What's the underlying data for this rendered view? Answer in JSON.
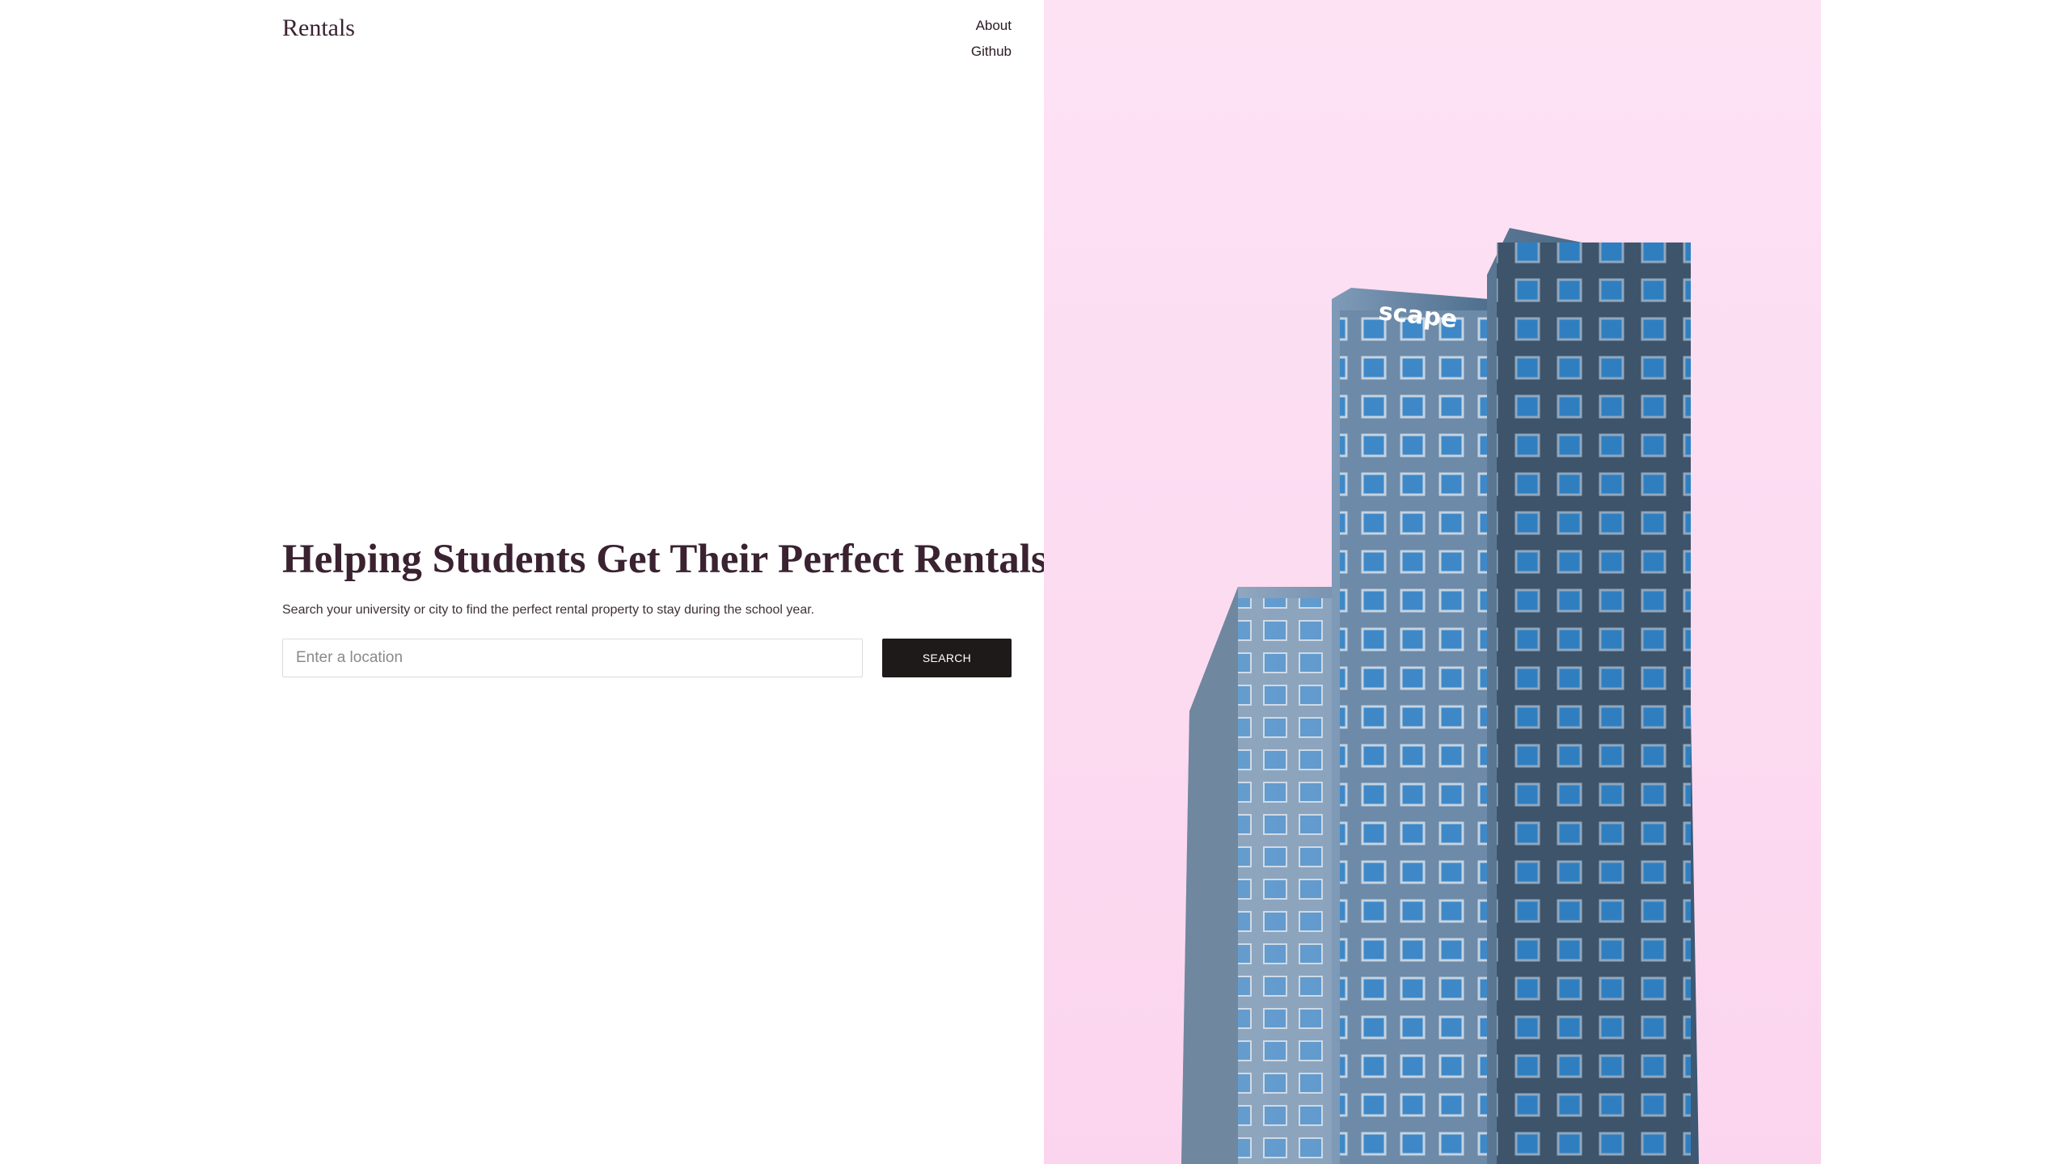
{
  "brand": {
    "title": "Rentals"
  },
  "nav": {
    "about": "About",
    "github": "Github"
  },
  "hero": {
    "headline": "Helping Students Get Their Perfect Rentals.",
    "subtitle": "Search your university or city to find the perfect rental property to stay during the school year.",
    "search": {
      "placeholder": "Enter a location",
      "value": "",
      "button_label": "SEARCH"
    }
  },
  "image": {
    "sign_text": "scape",
    "sky_color": "#fcdcf1",
    "building_color": "#5b7d9c"
  }
}
